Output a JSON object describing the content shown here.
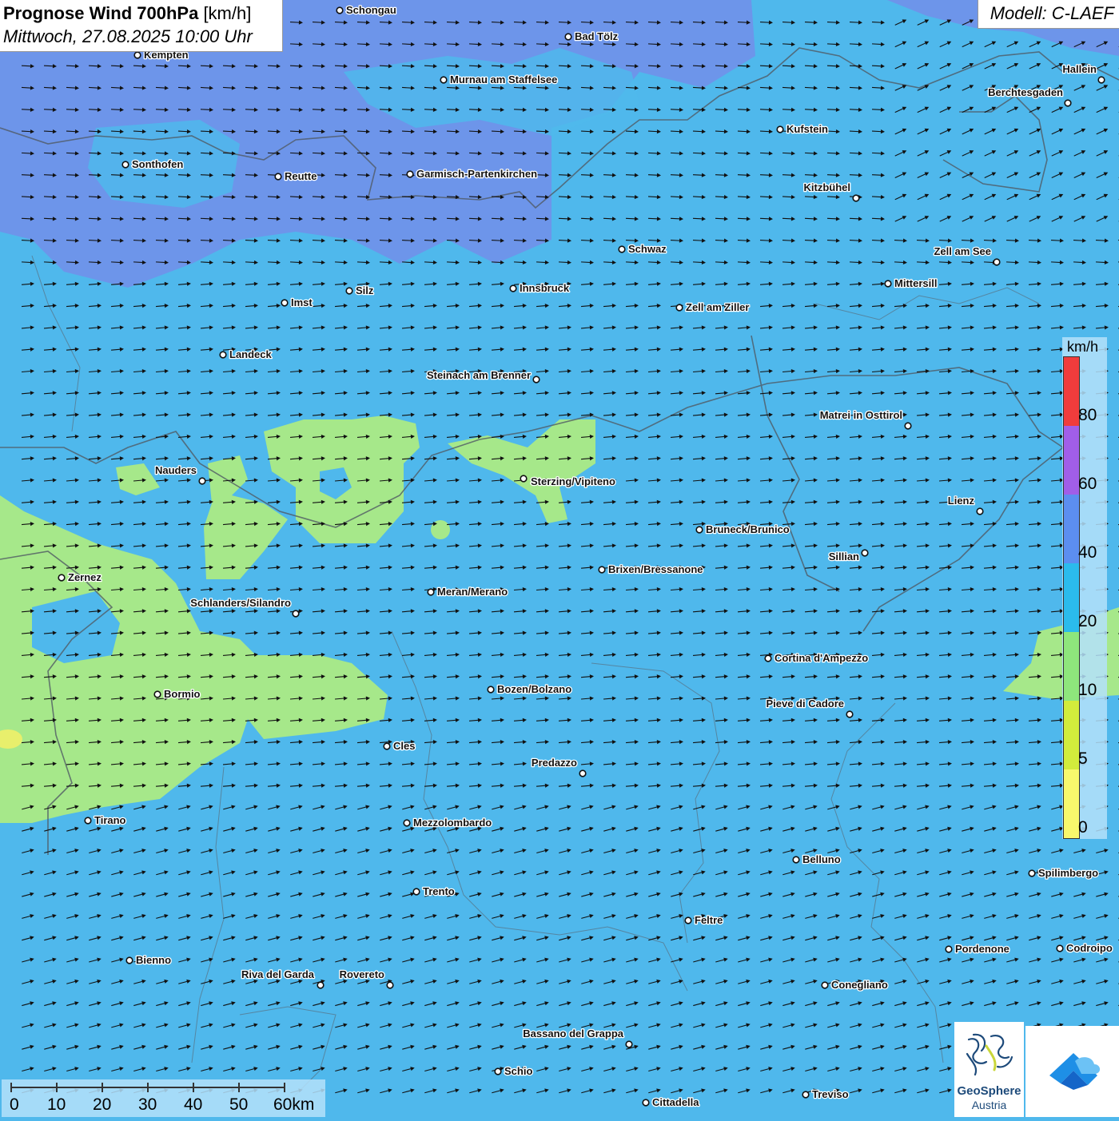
{
  "header": {
    "title_bold": "Prognose Wind 700hPa",
    "title_unit": "[km/h]",
    "subtitle": "Mittwoch, 27.08.2025 10:00 Uhr",
    "model": "Modell: C-LAEF"
  },
  "legend": {
    "unit": "km/h",
    "ticks": [
      "80",
      "60",
      "40",
      "20",
      "10",
      "5",
      "0"
    ],
    "colors": [
      "#f03c3c",
      "#a15ee8",
      "#5c8ef0",
      "#2bbbec",
      "#8ee67c",
      "#d2ec3c",
      "#f8f86c"
    ]
  },
  "scalebar": {
    "labels": [
      "0",
      "10",
      "20",
      "30",
      "40",
      "50",
      "60km"
    ]
  },
  "logo": {
    "name_line1": "GeoSphere",
    "name_line2": "Austria"
  },
  "colors": {
    "wind_10_20": "#4fb8ec",
    "wind_20_40": "#6d95ea",
    "wind_5_10": "#a6e88a",
    "wind_0_5": "#e8ef6c"
  },
  "cities": [
    {
      "name": "Schongau"
    },
    {
      "name": "Bad Tölz"
    },
    {
      "name": "Kempten"
    },
    {
      "name": "Murnau am Staffelsee"
    },
    {
      "name": "Hallein"
    },
    {
      "name": "Berchtesgaden"
    },
    {
      "name": "Kufstein"
    },
    {
      "name": "Sonthofen"
    },
    {
      "name": "Reutte"
    },
    {
      "name": "Garmisch-Partenkirchen"
    },
    {
      "name": "Kitzbühel"
    },
    {
      "name": "Schwaz"
    },
    {
      "name": "Zell am See"
    },
    {
      "name": "Mittersill"
    },
    {
      "name": "Silz"
    },
    {
      "name": "Innsbruck"
    },
    {
      "name": "Imst"
    },
    {
      "name": "Zell am Ziller"
    },
    {
      "name": "Landeck"
    },
    {
      "name": "Steinach am Brenner"
    },
    {
      "name": "Matrei in Osttirol"
    },
    {
      "name": "Nauders"
    },
    {
      "name": "Sterzing/Vipiteno"
    },
    {
      "name": "Lienz"
    },
    {
      "name": "Bruneck/Brunico"
    },
    {
      "name": "Sillian"
    },
    {
      "name": "Brixen/Bressanone"
    },
    {
      "name": "Zernez"
    },
    {
      "name": "Meran/Merano"
    },
    {
      "name": "Schlanders/Silandro"
    },
    {
      "name": "Cortina d'Ampezzo"
    },
    {
      "name": "Bozen/Bolzano"
    },
    {
      "name": "Bormio"
    },
    {
      "name": "Pieve di Cadore"
    },
    {
      "name": "Cles"
    },
    {
      "name": "Predazzo"
    },
    {
      "name": "Tirano"
    },
    {
      "name": "Mezzolombardo"
    },
    {
      "name": "Belluno"
    },
    {
      "name": "Spilimbergo"
    },
    {
      "name": "Trento"
    },
    {
      "name": "Feltre"
    },
    {
      "name": "Pordenone"
    },
    {
      "name": "Codroipo"
    },
    {
      "name": "Bienno"
    },
    {
      "name": "Riva del Garda"
    },
    {
      "name": "Rovereto"
    },
    {
      "name": "Conegliano"
    },
    {
      "name": "Bassano del Grappa"
    },
    {
      "name": "Schio"
    },
    {
      "name": "Treviso"
    },
    {
      "name": "Cittadella"
    }
  ]
}
